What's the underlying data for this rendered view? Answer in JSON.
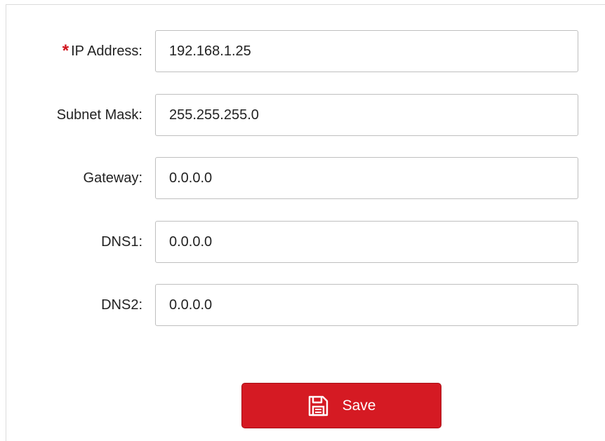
{
  "form": {
    "fields": [
      {
        "label": "IP Address:",
        "value": "192.168.1.25",
        "required": true,
        "required_mark": "*"
      },
      {
        "label": "Subnet Mask:",
        "value": "255.255.255.0",
        "required": false
      },
      {
        "label": "Gateway:",
        "value": "0.0.0.0",
        "required": false
      },
      {
        "label": "DNS1:",
        "value": "0.0.0.0",
        "required": false
      },
      {
        "label": "DNS2:",
        "value": "0.0.0.0",
        "required": false
      }
    ],
    "save_label": "Save",
    "save_icon": "floppy-disk-icon",
    "accent_color": "#d51a23",
    "required_color": "#d0121b"
  }
}
